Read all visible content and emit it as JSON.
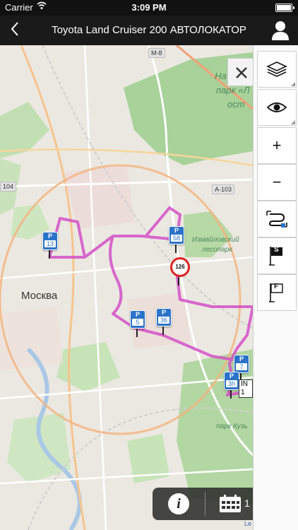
{
  "status_bar": {
    "carrier": "Carrier",
    "time": "3:09 PM"
  },
  "nav": {
    "back_icon": "chevron-left-icon",
    "title": "Toyota Land Cruiser 200 АВТОЛОКАТОР",
    "user_icon": "user-icon"
  },
  "map": {
    "city_label": "Москва",
    "road_labels": {
      "m8": "M-8",
      "a104": "104",
      "a103": "A-103"
    },
    "park_labels": {
      "park_line1": "На",
      "park_line2": "парк «Л",
      "park_line3": "ост",
      "izm_line1": "Измайловский",
      "izm_line2": "лесопарк",
      "kuz": "парк Кузь"
    },
    "parking_markers": [
      {
        "letter": "P",
        "number": "13"
      },
      {
        "letter": "P",
        "number": "58"
      },
      {
        "letter": "P",
        "number": "5"
      },
      {
        "letter": "P",
        "number": "36"
      },
      {
        "letter": "P",
        "number": "7"
      },
      {
        "letter": "P",
        "number": "3h"
      }
    ],
    "speed_sign": "126",
    "partial_tag": "IN 1",
    "attribution": "Le",
    "route_color": "#d44fc7"
  },
  "controls": {
    "close_icon": "close-icon",
    "tools": [
      {
        "name": "layers-icon"
      },
      {
        "name": "eye-icon"
      },
      {
        "name": "zoom-in-icon",
        "glyph": "+"
      },
      {
        "name": "zoom-out-icon",
        "glyph": "−"
      },
      {
        "name": "route-icon"
      },
      {
        "name": "start-flag-icon",
        "glyph": "S"
      },
      {
        "name": "finish-flag-icon",
        "glyph": "F"
      }
    ]
  },
  "bottom_bar": {
    "info_glyph": "i",
    "calendar_icon": "calendar-icon",
    "date_partial": "1"
  }
}
